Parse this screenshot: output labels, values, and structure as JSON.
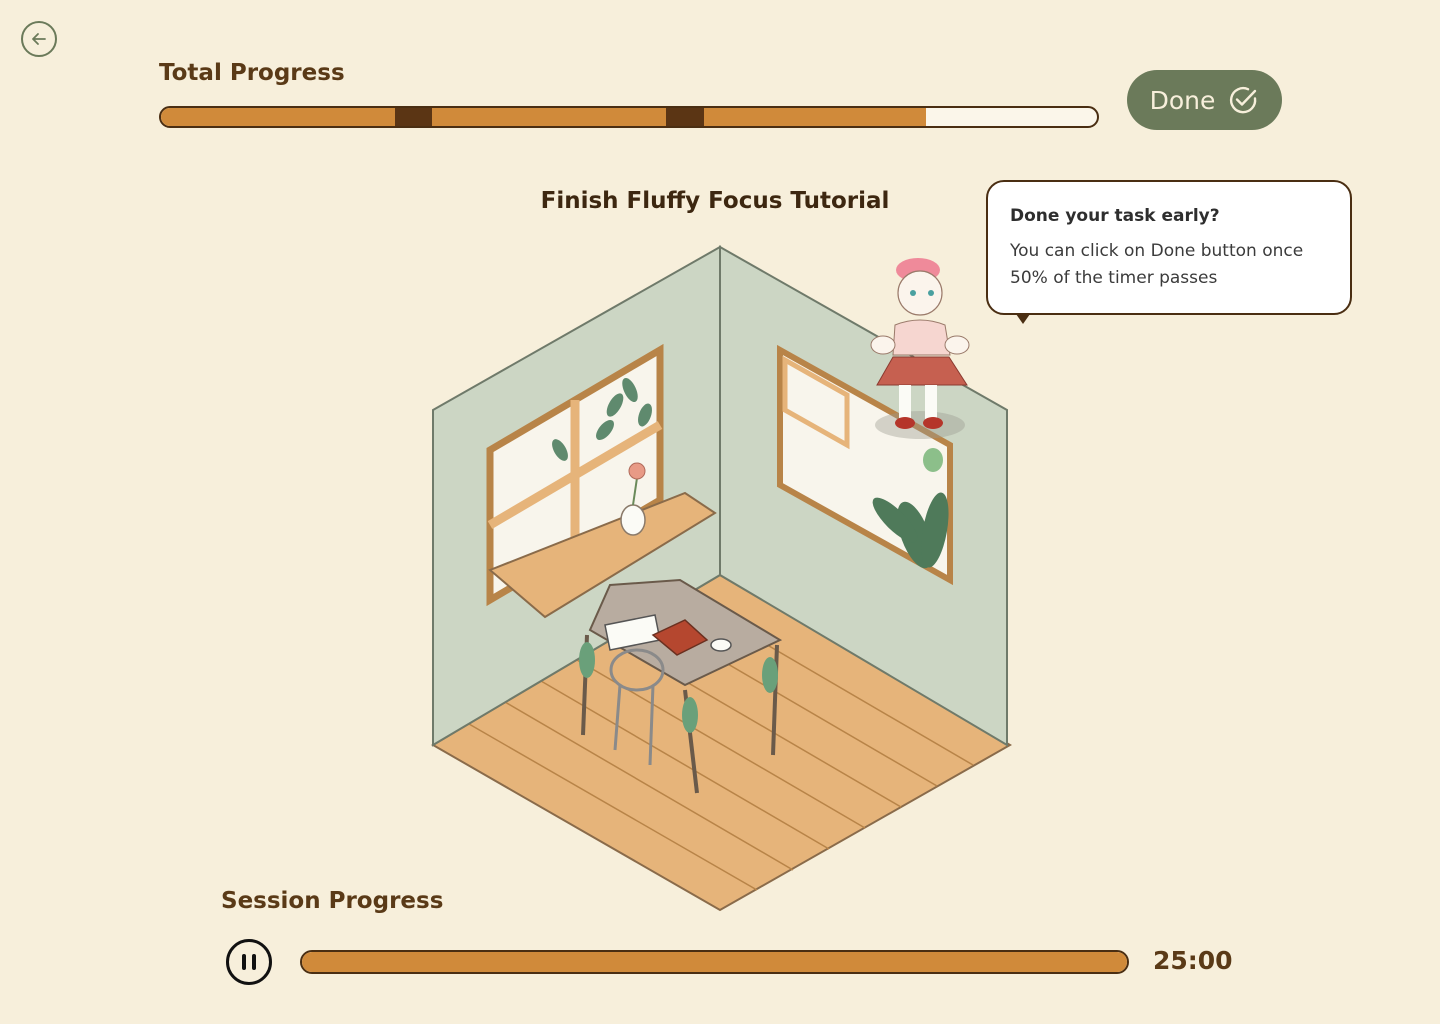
{
  "header": {
    "back_icon": "arrow-left-icon",
    "total_progress_label": "Total Progress",
    "total_progress": {
      "filled_fraction": 0.817,
      "segment_boundaries": [
        0.25,
        0.54
      ]
    },
    "done_button": {
      "label": "Done",
      "icon": "check-circle-icon"
    }
  },
  "main": {
    "task_title": "Finish Fluffy Focus Tutorial",
    "scene_image": "isometric-room-illustration"
  },
  "tooltip": {
    "title": "Done your task early?",
    "body": "You can click on Done button once 50% of the timer passes"
  },
  "session": {
    "label": "Session Progress",
    "pause_icon": "pause-icon",
    "progress_fraction": 1.0,
    "timer": "25:00"
  },
  "colors": {
    "background": "#f7efdb",
    "accent": "#d08a3a",
    "accent_dark": "#5b3514",
    "done_button": "#6b7a5a"
  }
}
